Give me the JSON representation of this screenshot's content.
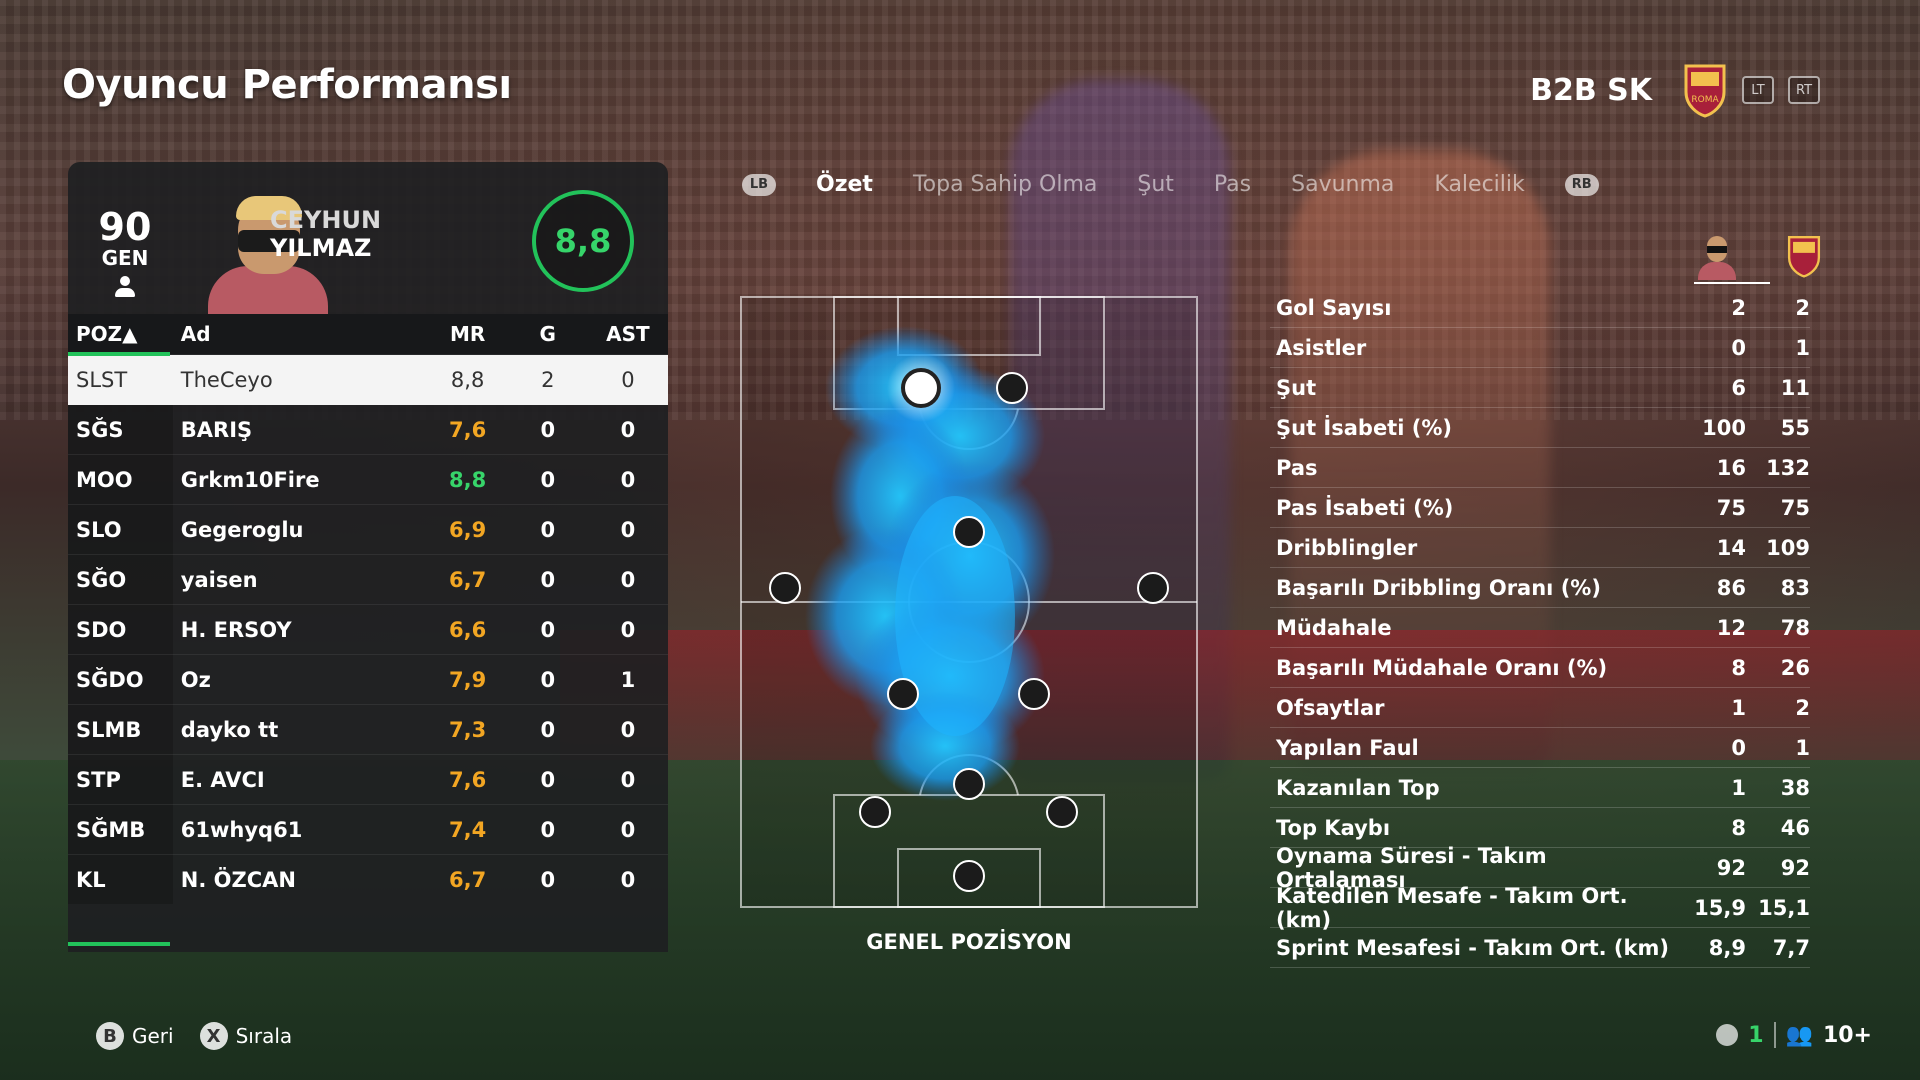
{
  "page": {
    "title": "Oyuncu Performansı"
  },
  "team": {
    "name": "B2B SK",
    "lt": "LT",
    "rt": "RT",
    "brand_color": "#a8203a"
  },
  "player": {
    "ovr": "90",
    "ovr_label": "GEN",
    "first_name": "CEYHUN",
    "last_name": "YILMAZ",
    "rating": "8,8"
  },
  "roster": {
    "headers": {
      "pos": "POZ▲",
      "name": "Ad",
      "mr": "MR",
      "g": "G",
      "ast": "AST"
    },
    "rows": [
      {
        "pos": "SLST",
        "name": "TheCeyo",
        "mr": "8,8",
        "g": "2",
        "ast": "0"
      },
      {
        "pos": "SĞS",
        "name": "BARIŞ",
        "mr": "7,6",
        "g": "0",
        "ast": "0"
      },
      {
        "pos": "MOO",
        "name": "Grkm10Fire",
        "mr": "8,8",
        "g": "0",
        "ast": "0"
      },
      {
        "pos": "SLO",
        "name": "Gegeroglu",
        "mr": "6,9",
        "g": "0",
        "ast": "0"
      },
      {
        "pos": "SĞO",
        "name": "yaisen",
        "mr": "6,7",
        "g": "0",
        "ast": "0"
      },
      {
        "pos": "SDO",
        "name": "H. ERSOY",
        "mr": "6,6",
        "g": "0",
        "ast": "0"
      },
      {
        "pos": "SĞDO",
        "name": "Oz",
        "mr": "7,9",
        "g": "0",
        "ast": "1"
      },
      {
        "pos": "SLMB",
        "name": "dayko tt",
        "mr": "7,3",
        "g": "0",
        "ast": "0"
      },
      {
        "pos": "STP",
        "name": "E. AVCI",
        "mr": "7,6",
        "g": "0",
        "ast": "0"
      },
      {
        "pos": "SĞMB",
        "name": "61whyq61",
        "mr": "7,4",
        "g": "0",
        "ast": "0"
      },
      {
        "pos": "KL",
        "name": "N. ÖZCAN",
        "mr": "6,7",
        "g": "0",
        "ast": "0"
      }
    ]
  },
  "tabs": {
    "lb": "LB",
    "rb": "RB",
    "items": [
      "Özet",
      "Topa Sahip Olma",
      "Şut",
      "Pas",
      "Savunma",
      "Kalecilik"
    ]
  },
  "pitch": {
    "label": "GENEL POZİSYON",
    "heatmap_color": "#16b6ff"
  },
  "stats": [
    {
      "label": "Gol Sayısı",
      "player": "2",
      "team": "2"
    },
    {
      "label": "Asistler",
      "player": "0",
      "team": "1"
    },
    {
      "label": "Şut",
      "player": "6",
      "team": "11"
    },
    {
      "label": "Şut İsabeti (%)",
      "player": "100",
      "team": "55"
    },
    {
      "label": "Pas",
      "player": "16",
      "team": "132"
    },
    {
      "label": "Pas İsabeti (%)",
      "player": "75",
      "team": "75"
    },
    {
      "label": "Dribblingler",
      "player": "14",
      "team": "109"
    },
    {
      "label": "Başarılı Dribbling Oranı (%)",
      "player": "86",
      "team": "83"
    },
    {
      "label": "Müdahale",
      "player": "12",
      "team": "78"
    },
    {
      "label": "Başarılı Müdahale Oranı (%)",
      "player": "8",
      "team": "26"
    },
    {
      "label": "Ofsaytlar",
      "player": "1",
      "team": "2"
    },
    {
      "label": "Yapılan Faul",
      "player": "0",
      "team": "1"
    },
    {
      "label": "Kazanılan Top",
      "player": "1",
      "team": "38"
    },
    {
      "label": "Top Kaybı",
      "player": "8",
      "team": "46"
    },
    {
      "label": "Oynama Süresi - Takım Ortalaması",
      "player": "92",
      "team": "92"
    },
    {
      "label": "Katedilen Mesafe - Takım Ort. (km)",
      "player": "15,9",
      "team": "15,1"
    },
    {
      "label": "Sprint Mesafesi - Takım Ort. (km)",
      "player": "8,9",
      "team": "7,7"
    }
  ],
  "footer": {
    "back_key": "B",
    "back_label": "Geri",
    "sort_key": "X",
    "sort_label": "Sırala",
    "count": "1",
    "players": "10+"
  }
}
